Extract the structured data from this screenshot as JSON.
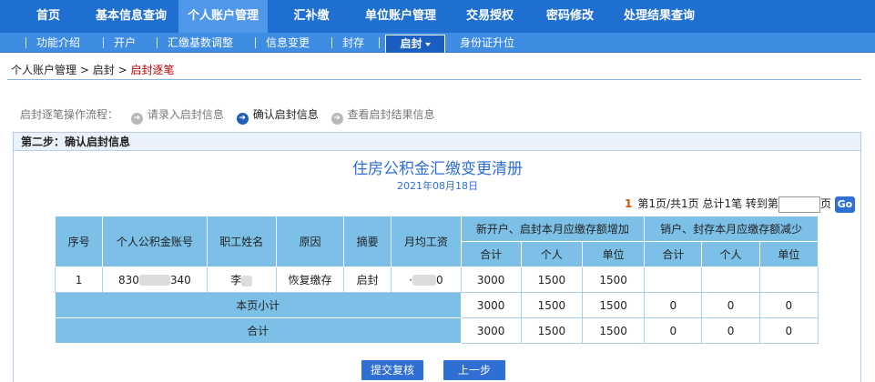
{
  "topnav": {
    "items": [
      {
        "label": "首页"
      },
      {
        "label": "基本信息查询"
      },
      {
        "label": "个人账户管理"
      },
      {
        "label": "汇补缴"
      },
      {
        "label": "单位账户管理"
      },
      {
        "label": "交易授权"
      },
      {
        "label": "密码修改"
      },
      {
        "label": "处理结果查询"
      }
    ]
  },
  "subnav": {
    "items": [
      {
        "label": "功能介绍"
      },
      {
        "label": "开户"
      },
      {
        "label": "汇缴基数调整"
      },
      {
        "label": "信息变更"
      },
      {
        "label": "封存"
      },
      {
        "label": "启封"
      },
      {
        "label": "身份证升位"
      }
    ]
  },
  "breadcrumb": {
    "part1": "个人账户管理",
    "sep": ">",
    "part2": "启封",
    "current": "启封逐笔"
  },
  "flow": {
    "label": "启封逐笔操作流程：",
    "steps": [
      {
        "label": "请录入启封信息"
      },
      {
        "label": "确认启封信息"
      },
      {
        "label": "查看启封结果信息"
      }
    ]
  },
  "panel": {
    "title": "第二步：确认启封信息"
  },
  "document": {
    "title": "住房公积金汇缴变更清册",
    "date": "2021年08月18日"
  },
  "pager": {
    "current": "1",
    "text": "第1页/共1页 总计1笔 转到第",
    "suffix": "页",
    "go": "Go"
  },
  "table": {
    "headers": {
      "seq": "序号",
      "account": "个人公积金账号",
      "name": "职工姓名",
      "reason": "原因",
      "summary": "摘要",
      "wage": "月均工资",
      "increase_group": "新开户、启封本月应缴存额增加",
      "decrease_group": "销户、封存本月应缴存额减少",
      "total": "合计",
      "personal": "个人",
      "unit": "单位"
    },
    "row": {
      "seq": "1",
      "account_prefix": "830",
      "account_suffix": "340",
      "name": "李",
      "reason": "恢复缴存",
      "summary": "启封",
      "wage_prefix": "·",
      "wage_suffix": "0",
      "inc_total": "3000",
      "inc_personal": "1500",
      "inc_unit": "1500",
      "dec_total": "",
      "dec_personal": "",
      "dec_unit": ""
    },
    "subtotal": {
      "label": "本页小计",
      "inc_total": "3000",
      "inc_personal": "1500",
      "inc_unit": "1500",
      "dec_total": "0",
      "dec_personal": "0",
      "dec_unit": "0"
    },
    "grandtotal": {
      "label": "合计",
      "inc_total": "3000",
      "inc_personal": "1500",
      "inc_unit": "1500",
      "dec_total": "0",
      "dec_personal": "0",
      "dec_unit": "0"
    }
  },
  "buttons": {
    "submit": "提交复核",
    "prev": "上一步"
  }
}
